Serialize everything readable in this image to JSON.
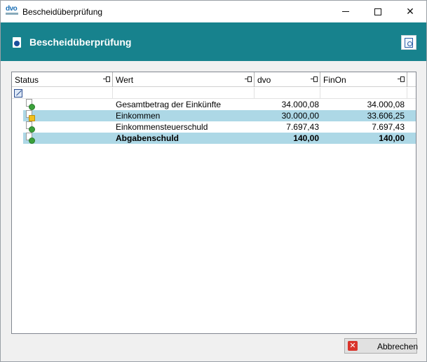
{
  "window": {
    "title": "Bescheidüberprüfung",
    "logo_text": "dvo"
  },
  "header": {
    "title": "Bescheidüberprüfung",
    "bg_color": "#17828d"
  },
  "grid": {
    "columns": [
      "Status",
      "Wert",
      "dvo",
      "FinOn"
    ],
    "rows": [
      {
        "status": "ok",
        "name": "Gesamtbetrag der Einkünfte",
        "dvo": "34.000,08",
        "finon": "34.000,08",
        "highlight": false,
        "bold": false
      },
      {
        "status": "warning",
        "name": "Einkommen",
        "dvo": "30.000,00",
        "finon": "33.606,25",
        "highlight": true,
        "bold": false
      },
      {
        "status": "ok",
        "name": "Einkommensteuerschuld",
        "dvo": "7.697,43",
        "finon": "7.697,43",
        "highlight": false,
        "bold": false
      },
      {
        "status": "ok",
        "name": "Abgabenschuld",
        "dvo": "140,00",
        "finon": "140,00",
        "highlight": true,
        "bold": true
      }
    ],
    "highlight_color": "#add8e6"
  },
  "footer": {
    "cancel_label": "Abbrechen"
  }
}
